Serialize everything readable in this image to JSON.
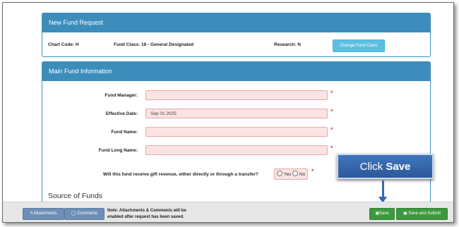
{
  "new_fund_panel": {
    "title": "New Fund Request",
    "chart_code": "Chart Code: H",
    "fund_class": "Fund Class: 18 - General Designated",
    "research": "Research: N",
    "change_button": "Change Fund Class"
  },
  "main_panel": {
    "title": "Main Fund Information",
    "fields": [
      {
        "label": "Fund Manager:",
        "value": ""
      },
      {
        "label": "Effective Date:",
        "value": "Sep 01 2025"
      },
      {
        "label": "Fund Name:",
        "value": ""
      },
      {
        "label": "Fund Long Name:",
        "value": ""
      }
    ],
    "required_mark": "*",
    "gift_question": "Will this fund receive gift revenue, either directly or through a transfer?",
    "yes_label": "Yes",
    "no_label": "No",
    "source_heading": "Source of Funds"
  },
  "callout": {
    "prefix": "Click ",
    "bold": "Save"
  },
  "footer": {
    "attachments": "Attachments",
    "comments": "Comments",
    "note_line1": "Note: Attachments & Comments will be",
    "note_line2": "enabled after request has been saved.",
    "save": "Save",
    "save_submit": "Save and Submit"
  }
}
